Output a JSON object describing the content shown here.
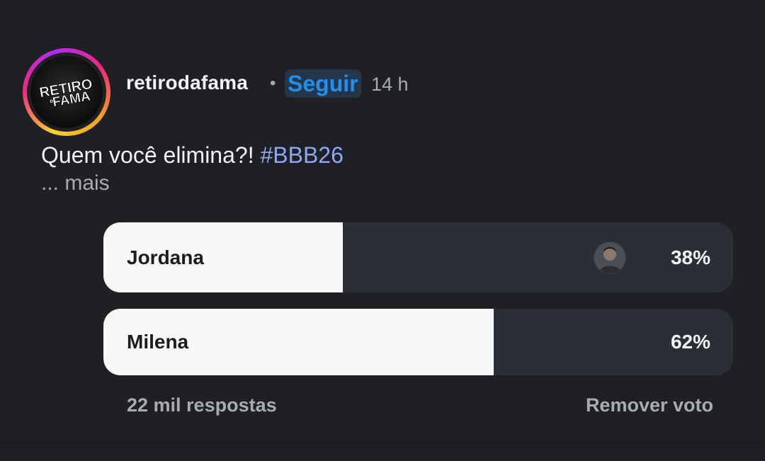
{
  "post": {
    "username": "retirodafama",
    "separator": "•",
    "follow_label": "Seguir",
    "timestamp": "14 h",
    "avatar_icon": "retiro-da-fama-logo",
    "avatar_logo_text": "RETIRO DA FAMA",
    "caption_text": "Quem você elimina?! ",
    "hashtag": "#BBB26",
    "more_label": "... mais"
  },
  "poll": {
    "options": [
      {
        "label": "Jordana",
        "percent_label": "38%",
        "percent": 38,
        "has_voter_avatar": true
      },
      {
        "label": "Milena",
        "percent_label": "62%",
        "percent": 62,
        "has_voter_avatar": false
      }
    ],
    "responses_label": "22 mil respostas",
    "remove_vote_label": "Remover voto"
  },
  "colors": {
    "background": "#1f2024",
    "accent_blue": "#1f8ff0",
    "hashtag": "#8ea7f5",
    "poll_fill": "#f6f8f7",
    "poll_track": "#2b2e35",
    "muted_text": "#a8abb2"
  }
}
